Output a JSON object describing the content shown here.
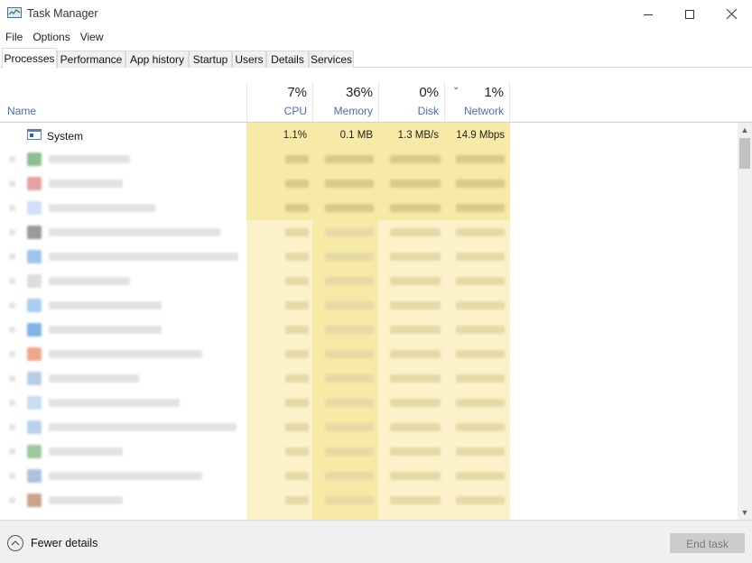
{
  "window": {
    "title": "Task Manager",
    "controls": [
      "minimize-icon",
      "maximize-icon",
      "close-icon"
    ]
  },
  "menu": [
    "File",
    "Options",
    "View"
  ],
  "tabs": [
    {
      "label": "Processes",
      "active": true
    },
    {
      "label": "Performance"
    },
    {
      "label": "App history"
    },
    {
      "label": "Startup"
    },
    {
      "label": "Users"
    },
    {
      "label": "Details"
    },
    {
      "label": "Services"
    }
  ],
  "columns": {
    "name": "Name",
    "cpu": {
      "pct": "7%",
      "label": "CPU"
    },
    "memory": {
      "pct": "36%",
      "label": "Memory"
    },
    "disk": {
      "pct": "0%",
      "label": "Disk"
    },
    "network": {
      "pct": "1%",
      "label": "Network"
    }
  },
  "processes": [
    {
      "name": "System",
      "cpu": "1.1%",
      "memory": "0.1 MB",
      "disk": "1.3 MB/s",
      "network": "14.9 Mbps",
      "icon": "system-window-icon"
    }
  ],
  "footer": {
    "fewer_details": "Fewer details",
    "end_task": "End task"
  },
  "colors": {
    "heat_strong": "#f7e9a6",
    "heat_light": "#fcf2c9",
    "header_label": "#4b6eaf"
  }
}
